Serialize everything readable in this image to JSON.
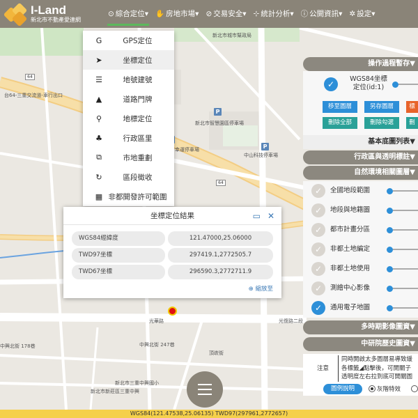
{
  "app": {
    "name": "I-Land",
    "subtitle": "新北市不動產愛連網",
    "brand_color": "#8a8478",
    "accent_color": "#2d8fd8"
  },
  "nav": [
    {
      "icon": "map-pin-icon",
      "glyph": "⊙",
      "label": "綜合定位▾",
      "active": true
    },
    {
      "icon": "hand-icon",
      "glyph": "✋",
      "label": "房地市場▾"
    },
    {
      "icon": "check-circle-icon",
      "glyph": "⊘",
      "label": "交易安全▾"
    },
    {
      "icon": "chart-icon",
      "glyph": "⊹",
      "label": "統計分析▾"
    },
    {
      "icon": "info-icon",
      "glyph": "ⓘ",
      "label": "公開資訊▾"
    },
    {
      "icon": "gear-icon",
      "glyph": "✲",
      "label": "設定▾"
    }
  ],
  "dropdown": [
    {
      "icon": "gps-icon",
      "glyph": "G",
      "label": "GPS定位"
    },
    {
      "icon": "arrow-icon",
      "glyph": "➤",
      "label": "坐標定位",
      "selected": true
    },
    {
      "icon": "list-icon",
      "glyph": "☰",
      "label": "地號建號"
    },
    {
      "icon": "road-icon",
      "glyph": "▲",
      "label": "道路門牌"
    },
    {
      "icon": "marker-icon",
      "glyph": "⚲",
      "label": "地標定位"
    },
    {
      "icon": "org-icon",
      "glyph": "♣",
      "label": "行政區里"
    },
    {
      "icon": "copy-icon",
      "glyph": "⧉",
      "label": "市地重劃"
    },
    {
      "icon": "refresh-icon",
      "glyph": "↻",
      "label": "區段徵收"
    },
    {
      "icon": "calendar-icon",
      "glyph": "▦",
      "label": "非都開發許可範圍"
    }
  ],
  "result": {
    "title": "坐標定位結果",
    "rows": [
      {
        "key": "WGS84經緯度",
        "value": "121.47000,25.06000"
      },
      {
        "key": "TWD97坐標",
        "value": "297419.1,2772505.7"
      },
      {
        "key": "TWD67坐標",
        "value": "296590.3,2772711.9"
      }
    ],
    "zoom_label": "縮放至"
  },
  "panel": {
    "ops_title": "操作過程暫存▼",
    "wgs_label_1": "WGS84坐標",
    "wgs_label_2": "定位(id:1)",
    "buttons": [
      "移至圖層",
      "另存圖層",
      "標",
      "刪除全部",
      "刪除勾選",
      "刪"
    ],
    "basemap_title": "基本底圖列表▼",
    "admin_title": "行政區與透明標註▼",
    "env_title": "自然環境相關圖層▼",
    "layers": [
      {
        "label": "全國地段範圍",
        "checked": false
      },
      {
        "label": "地段與地籍圖",
        "checked": false
      },
      {
        "label": "都市計畫分區",
        "checked": false
      },
      {
        "label": "非都土地編定",
        "checked": false
      },
      {
        "label": "非都土地使用",
        "checked": false
      },
      {
        "label": "測繪中心影像",
        "checked": false
      },
      {
        "label": "通用電子地圖",
        "checked": true
      }
    ],
    "multi_title": "多時期影像圖資▼",
    "history_title": "中研院歷史圖資▼",
    "notes_label": "注意",
    "notes": [
      "同時開啟太多圖層易導致緩",
      "各標籤◢點擊後，可開關子",
      "透明度左右拉到底可開關圖"
    ],
    "legend_button": "圖例說明",
    "radio_1": "灰階特效"
  },
  "map": {
    "labels": [
      {
        "text": "台64-三重交流道-車行出口"
      },
      {
        "text": "光華路"
      },
      {
        "text": "光復路二段"
      },
      {
        "text": "中興北街 247巷"
      },
      {
        "text": "中興北街 178巷"
      },
      {
        "text": "頂崁街"
      },
      {
        "text": "新北市三重中興國小"
      },
      {
        "text": "新北市新莊區三重中興"
      },
      {
        "text": "新北市城市幫政局"
      },
      {
        "text": "新北市智慧園區停車場"
      },
      {
        "text": "中山科技停車場"
      },
      {
        "text": "新北市幸運停車場"
      }
    ]
  },
  "footer": "WGS84(121.47538,25.06135) TWD97(297961,2772657)"
}
